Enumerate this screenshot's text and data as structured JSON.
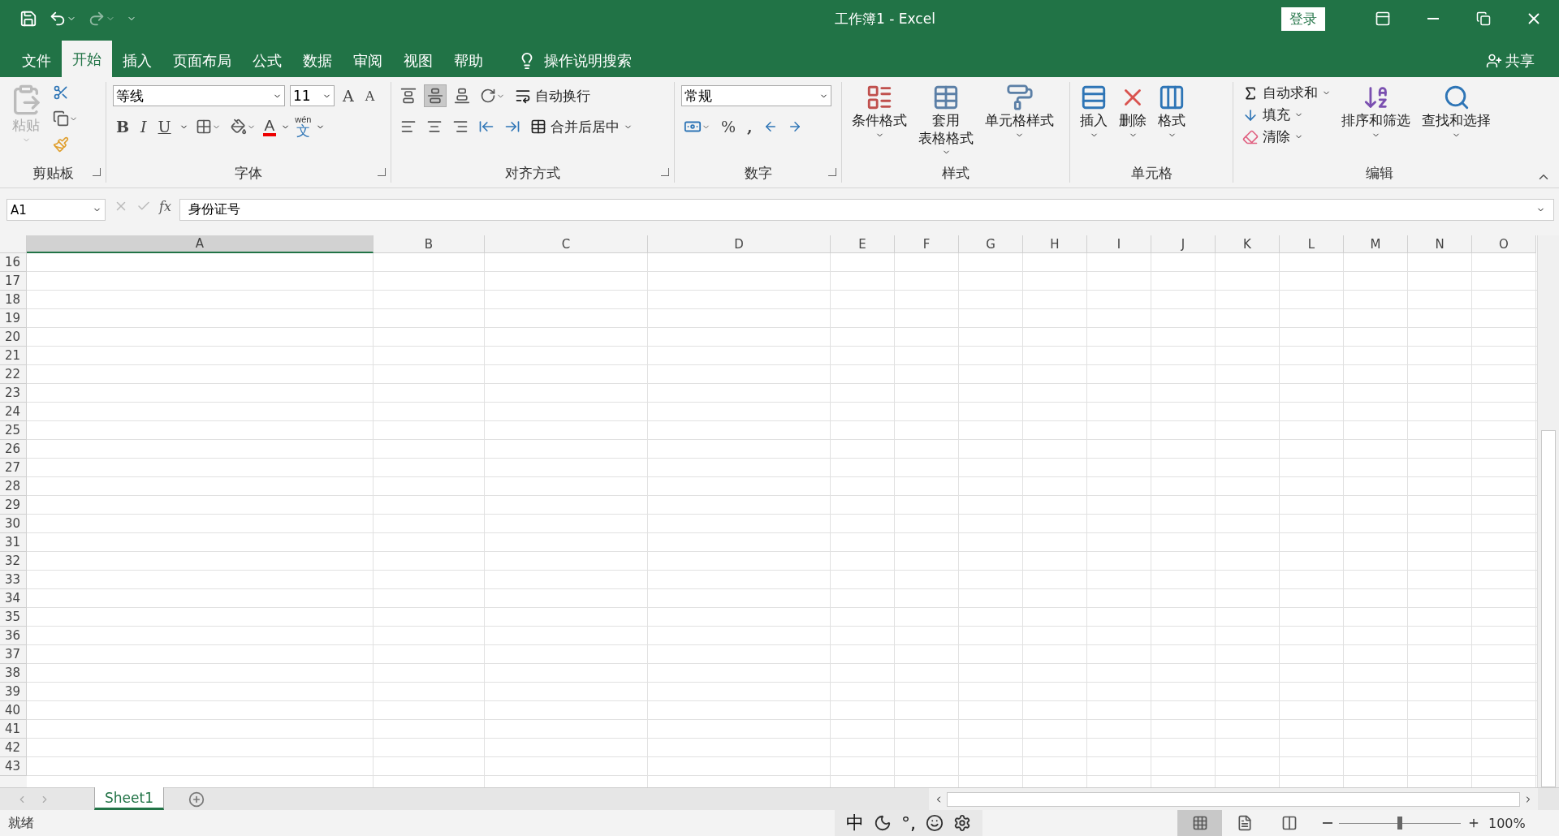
{
  "window": {
    "title": "工作簿1  -  Excel",
    "login": "登录",
    "share": "共享"
  },
  "tabs": [
    {
      "label": "文件",
      "selected": false
    },
    {
      "label": "开始",
      "selected": true
    },
    {
      "label": "插入",
      "selected": false
    },
    {
      "label": "页面布局",
      "selected": false
    },
    {
      "label": "公式",
      "selected": false
    },
    {
      "label": "数据",
      "selected": false
    },
    {
      "label": "审阅",
      "selected": false
    },
    {
      "label": "视图",
      "selected": false
    },
    {
      "label": "帮助",
      "selected": false
    }
  ],
  "tell_me": "操作说明搜索",
  "ribbon": {
    "clipboard": {
      "label": "剪贴板",
      "paste": "粘贴"
    },
    "font": {
      "label": "字体",
      "font_name": "等线",
      "font_size": "11",
      "grow": "A",
      "shrink": "A",
      "bold": "B",
      "italic": "I",
      "underline": "U",
      "font_color": "A",
      "phonetic_top": "wén",
      "phonetic_bottom": "文"
    },
    "alignment": {
      "label": "对齐方式",
      "wrap": "自动换行",
      "merge": "合并后居中"
    },
    "number": {
      "label": "数字",
      "format": "常规",
      "percent": "%",
      "comma": ","
    },
    "styles": {
      "label": "样式",
      "buttons": [
        {
          "lines": [
            "条件格式"
          ]
        },
        {
          "lines": [
            "套用",
            "表格格式"
          ]
        },
        {
          "lines": [
            "单元格样式"
          ]
        }
      ]
    },
    "cells": {
      "label": "单元格",
      "buttons": [
        "插入",
        "删除",
        "格式"
      ]
    },
    "editing": {
      "label": "编辑",
      "autosum": "自动求和",
      "fill": "填充",
      "clear": "清除",
      "sort": "排序和筛选",
      "find": "查找和选择"
    }
  },
  "formula_bar": {
    "name_box": "A1",
    "fx": "fx",
    "value": "身份证号"
  },
  "columns": [
    {
      "label": "A",
      "selected": true
    },
    {
      "label": "B",
      "selected": false
    },
    {
      "label": "C",
      "selected": false
    },
    {
      "label": "D",
      "selected": false
    },
    {
      "label": "E",
      "selected": false
    },
    {
      "label": "F",
      "selected": false
    },
    {
      "label": "G",
      "selected": false
    },
    {
      "label": "H",
      "selected": false
    },
    {
      "label": "I",
      "selected": false
    },
    {
      "label": "J",
      "selected": false
    },
    {
      "label": "K",
      "selected": false
    },
    {
      "label": "L",
      "selected": false
    },
    {
      "label": "M",
      "selected": false
    },
    {
      "label": "N",
      "selected": false
    },
    {
      "label": "O",
      "selected": false
    }
  ],
  "rows": [
    "16",
    "17",
    "18",
    "19",
    "20",
    "21",
    "22",
    "23",
    "24",
    "25",
    "26",
    "27",
    "28",
    "29",
    "30",
    "31",
    "32",
    "33",
    "34",
    "35",
    "36",
    "37",
    "38",
    "39",
    "40",
    "41",
    "42",
    "43"
  ],
  "sheets": [
    {
      "label": "Sheet1",
      "selected": true
    }
  ],
  "ime": {
    "mode": "中",
    "punct": "°,"
  },
  "status_bar": {
    "status": "就绪",
    "views": [
      {
        "kind": "normal",
        "selected": true
      },
      {
        "kind": "page_layout",
        "selected": false
      },
      {
        "kind": "page_break",
        "selected": false
      }
    ],
    "zoom": {
      "level": 0.5,
      "reading": "100%"
    }
  }
}
